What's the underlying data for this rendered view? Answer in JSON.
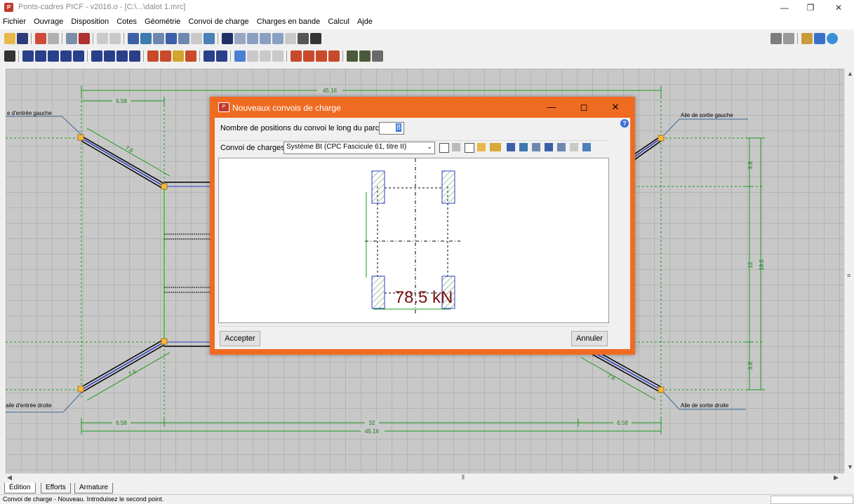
{
  "window": {
    "title": "Ponts-cadres PICF - v2016.o - [C:\\...\\dalot 1.mrc]",
    "minimize": "—",
    "restore": "❐",
    "close": "✕"
  },
  "menu": [
    "Fichier",
    "Ouvrage",
    "Disposition",
    "Cotes",
    "Géométrie",
    "Convoi de charge",
    "Charges en bande",
    "Calcul",
    "Ajde"
  ],
  "drawing": {
    "dim_top_total": "45.16",
    "dim_top_left": "6.58",
    "dim_bottom_left": "6.58",
    "dim_bottom_mid": "32",
    "dim_bottom_right": "6.58",
    "dim_bottom_total": "45.16",
    "dim_right_top": "3.8",
    "dim_right_mid": "12",
    "dim_right_total": "19.6",
    "dim_right_bottom": "3.8",
    "wing_len_tl": "7.6",
    "wing_len_bl": "7.6",
    "wing_len_br": "7.6",
    "label_tl": "e d'entrée gauche",
    "label_tr": "Aile de sortie gauche",
    "label_bl": "aile d'entrée droite",
    "label_br": "Aile de sortie droite"
  },
  "dialog": {
    "title": "Nouveaux convois de charge",
    "minimize": "—",
    "maximize": "◻",
    "close": "✕",
    "positions_label": "Nombre de positions du convoi le long du parcours",
    "positions_value": "8",
    "convoy_label": "Convoi de charges",
    "convoy_selected": "Système Bt (CPC Fascicule 61, titre II)",
    "load_label": "78.5 kN",
    "accept": "Accepter",
    "cancel": "Annuler"
  },
  "tabs": [
    "Édition",
    "Efforts",
    "Armature"
  ],
  "status": "Convoi de charge - Nouveau.  Introduisez le second point.",
  "colors": {
    "dialog_frame": "#f06b22",
    "dimension": "#1a9a1a",
    "wing_axis": "#2c3cc8",
    "load_text": "#7b1212",
    "node": "#f5b742"
  }
}
